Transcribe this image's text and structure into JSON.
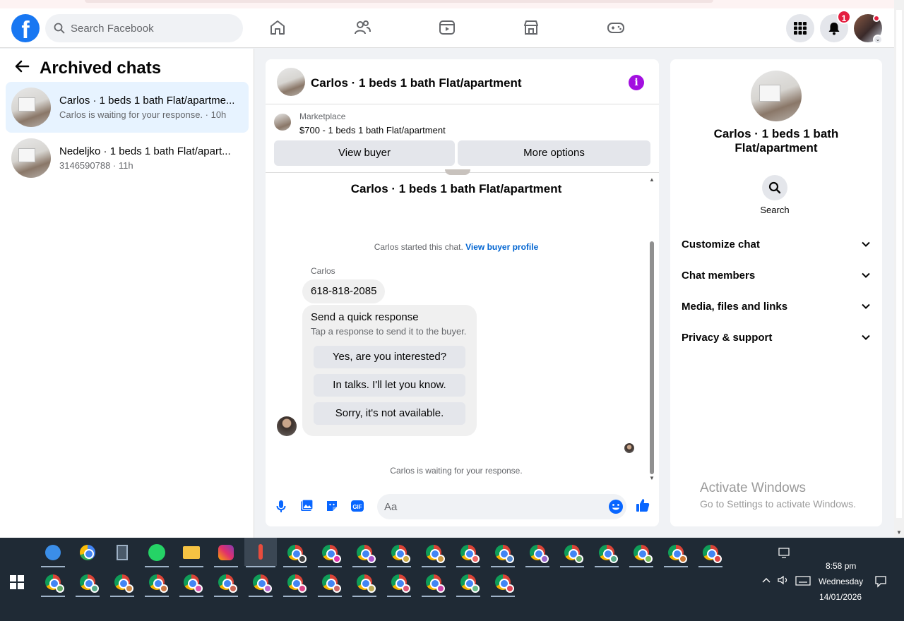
{
  "header": {
    "search_placeholder": "Search Facebook",
    "notification_count": "1"
  },
  "left_panel": {
    "title": "Archived chats",
    "chats": [
      {
        "name": "Carlos · 1 beds 1 bath Flat/apartme...",
        "subtitle": "Carlos is waiting for your response. · 10h"
      },
      {
        "name": "Nedeljko · 1 beds 1 bath Flat/apart...",
        "subtitle": "3146590788 · 11h"
      }
    ]
  },
  "conversation": {
    "title": "Carlos · 1 beds 1 bath Flat/apartment",
    "marketplace_label": "Marketplace",
    "listing": "$700 - 1 beds 1 bath Flat/apartment",
    "view_buyer_label": "View buyer",
    "more_options_label": "More options",
    "big_title": "Carlos · 1 beds 1 bath Flat/apartment",
    "started_text": "Carlos started this chat.",
    "view_profile_link": "View buyer profile",
    "sender_name": "Carlos",
    "phone_message": "618-818-2085",
    "quick_response_title": "Send a quick response",
    "quick_response_sub": "Tap a response to send it to the buyer.",
    "quick_responses": [
      "Yes, are you interested?",
      "In talks. I'll let you know.",
      "Sorry, it's not available."
    ],
    "waiting_text": "Carlos is waiting for your response.",
    "composer_placeholder": "Aa"
  },
  "right_panel": {
    "title": "Carlos · 1 beds 1 bath Flat/apartment",
    "search_label": "Search",
    "sections": [
      "Customize chat",
      "Chat members",
      "Media, files and links",
      "Privacy & support"
    ]
  },
  "watermark": {
    "line1": "Activate Windows",
    "line2": "Go to Settings to activate Windows."
  },
  "taskbar": {
    "time": "8:58 pm",
    "day": "Wednesday",
    "date": "14/01/2026"
  },
  "colors": {
    "brand": "#1877f2",
    "accent_purple": "#a30fe0",
    "badge_red": "#e41e3f",
    "link_blue": "#0064d1"
  }
}
